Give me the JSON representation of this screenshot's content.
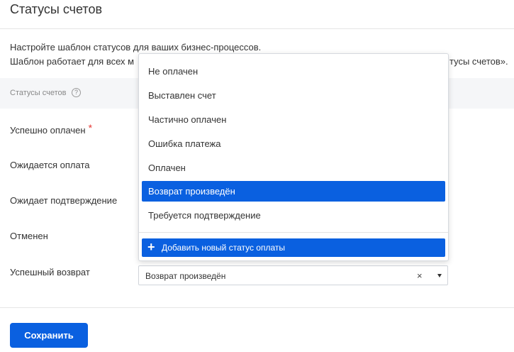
{
  "header": {
    "title": "Статусы счетов"
  },
  "description": {
    "line1": "Настройте шаблон статусов для ваших бизнес-процессов.",
    "line2_start": "Шаблон работает для всех м",
    "line2_end": "тусы счетов»."
  },
  "section": {
    "label": "Статусы счетов",
    "help_glyph": "?"
  },
  "rows": [
    {
      "label": "Успешно оплачен",
      "required_mark": "*"
    },
    {
      "label": "Ожидается оплата"
    },
    {
      "label": "Ожидает подтверждение"
    },
    {
      "label": "Отменен"
    },
    {
      "label": "Успешный возврат"
    }
  ],
  "select": {
    "value": "Возврат произведён",
    "clear_glyph": "×"
  },
  "dropdown": {
    "options": [
      {
        "label": "Не оплачен",
        "selected": false
      },
      {
        "label": "Выставлен счет",
        "selected": false
      },
      {
        "label": "Частично оплачен",
        "selected": false
      },
      {
        "label": "Ошибка платежа",
        "selected": false
      },
      {
        "label": "Оплачен",
        "selected": false
      },
      {
        "label": "Возврат произведён",
        "selected": true
      },
      {
        "label": "Требуется подтверждение",
        "selected": false
      }
    ],
    "add_label": "Добавить новый статус оплаты",
    "add_glyph": "+"
  },
  "footer": {
    "save_label": "Сохранить"
  },
  "colors": {
    "accent": "#0a60e0",
    "required": "#e53935",
    "section_bg": "#f5f6f8"
  }
}
